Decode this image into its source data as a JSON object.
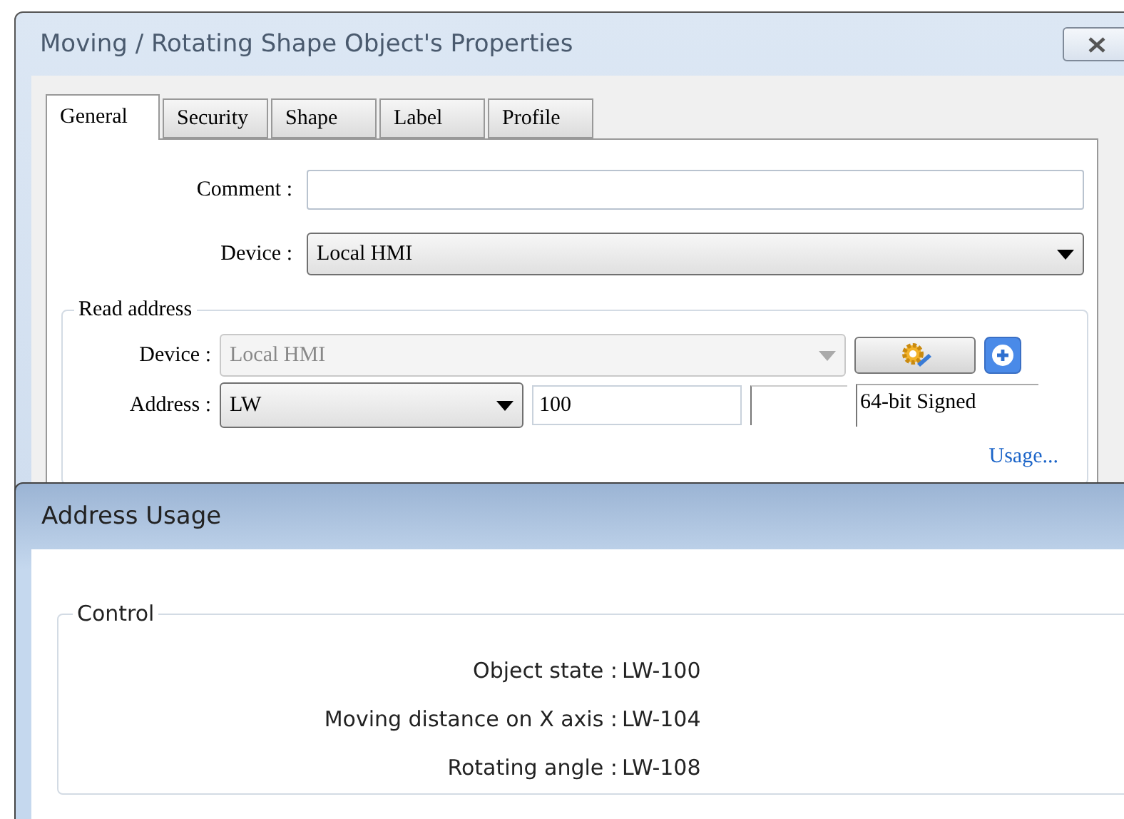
{
  "main_window": {
    "title": "Moving / Rotating Shape Object's Properties",
    "tabs": [
      {
        "label": "General",
        "selected": true
      },
      {
        "label": "Security",
        "selected": false
      },
      {
        "label": "Shape",
        "selected": false
      },
      {
        "label": "Label",
        "selected": false
      },
      {
        "label": "Profile",
        "selected": false
      }
    ],
    "comment": {
      "label": "Comment :"
    },
    "device": {
      "label": "Device :",
      "value": "Local HMI"
    },
    "read_address": {
      "title": "Read address",
      "device": {
        "label": "Device :",
        "value": "Local HMI",
        "disabled": true
      },
      "address": {
        "label": "Address :",
        "value": "LW",
        "number": "100",
        "data_type": "64-bit Signed"
      },
      "usage_link": "Usage..."
    }
  },
  "usage_window": {
    "title": "Address Usage",
    "group": "Control",
    "rows": [
      {
        "label": "Object state :",
        "value": "LW-100"
      },
      {
        "label": "Moving distance on X axis :",
        "value": "LW-104"
      },
      {
        "label": "Rotating angle :",
        "value": "LW-108"
      }
    ]
  }
}
